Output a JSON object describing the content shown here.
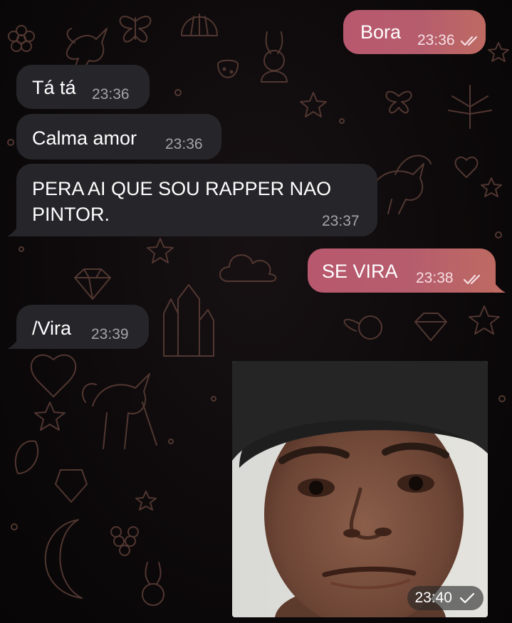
{
  "messages": [
    {
      "direction": "outgoing",
      "text": "Bora",
      "time": "23:36",
      "status": "read"
    },
    {
      "direction": "incoming",
      "text": "Tá tá",
      "time": "23:36"
    },
    {
      "direction": "incoming",
      "text": "Calma amor",
      "time": "23:36"
    },
    {
      "direction": "incoming",
      "text_line1": "PERA AI QUE SOU RAPPER NAO",
      "text_line2": "PINTOR.",
      "time": "23:37"
    },
    {
      "direction": "outgoing",
      "text": "SE VIRA",
      "time": "23:38",
      "status": "read"
    },
    {
      "direction": "incoming",
      "text": "/Vira",
      "time": "23:39"
    },
    {
      "direction": "outgoing",
      "type": "photo",
      "time": "23:40",
      "status": "sent"
    }
  ],
  "colors": {
    "background": "#0d0a0c",
    "incoming_bubble": "#26262a",
    "outgoing_bubble": "#b65d6d",
    "doodle": "#6b4a40"
  },
  "icons": {
    "read_status": "double-check-icon",
    "sent_status": "single-check-icon"
  }
}
